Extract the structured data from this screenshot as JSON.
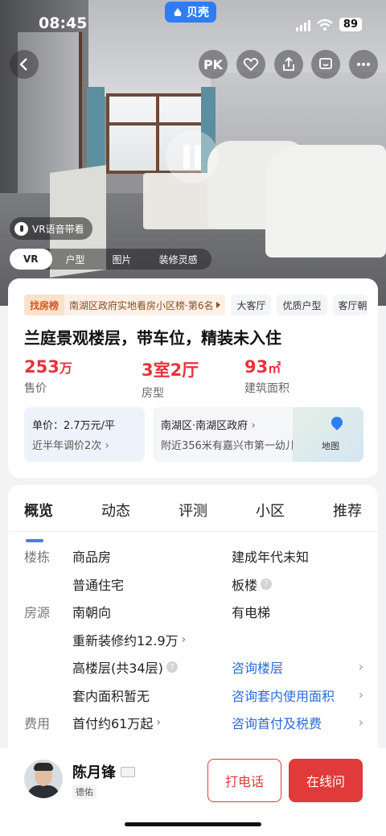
{
  "status": {
    "time": "08:45",
    "battery": "89"
  },
  "app_chip": {
    "label": "贝壳"
  },
  "nav": {
    "pk_label": "PK"
  },
  "hero": {
    "vr_guide_label": "VR语音带看",
    "media_tabs": [
      "VR",
      "户型",
      "图片",
      "装修灵感"
    ]
  },
  "ranking": {
    "badge": "找房榜",
    "text": "南湖区政府实地看房小区榜·第6名"
  },
  "tags": [
    "大客厅",
    "优质户型",
    "客厅朝"
  ],
  "listing": {
    "title": "兰庭景观楼层，带车位，精装未入住",
    "price_value": "253",
    "price_unit": "万",
    "price_label": "售价",
    "layout_value": "3室2厅",
    "layout_label": "房型",
    "area_value": "93",
    "area_unit": "㎡",
    "area_label": "建筑面积"
  },
  "price_box": {
    "line1": "单价：2.7万元/平",
    "line2": "近半年调价2次"
  },
  "location_box": {
    "line1": "南湖区·南湖区政府",
    "line2": "附近356米有嘉兴市第一幼儿...",
    "map_label": "地图"
  },
  "tabs": [
    "概览",
    "动态",
    "评测",
    "小区",
    "推荐"
  ],
  "overview": {
    "cat_building": "楼栋",
    "cat_listing": "房源",
    "cat_cost": "费用",
    "r1_c1": "商品房",
    "r1_c2": "建成年代未知",
    "r2_c1": "普通住宅",
    "r2_c2": "板楼",
    "r3_c1": "南朝向",
    "r3_c2": "有电梯",
    "r4_c1": "重新装修约12.9万",
    "r5_c1": "高楼层(共34层)",
    "r5_c2": "咨询楼层",
    "r6_c1": "套内面积暂无",
    "r6_c2": "咨询套内使用面积",
    "r7_c1": "首付约61万起",
    "r7_c2": "咨询首付及税费"
  },
  "agent": {
    "name": "陈月锋",
    "company": "德佑"
  },
  "actions": {
    "call": "打电话",
    "chat": "在线问"
  },
  "colors": {
    "accent_red": "#e8323c",
    "link_blue": "#2f6bd8",
    "brand_blue": "#2f7df5"
  }
}
